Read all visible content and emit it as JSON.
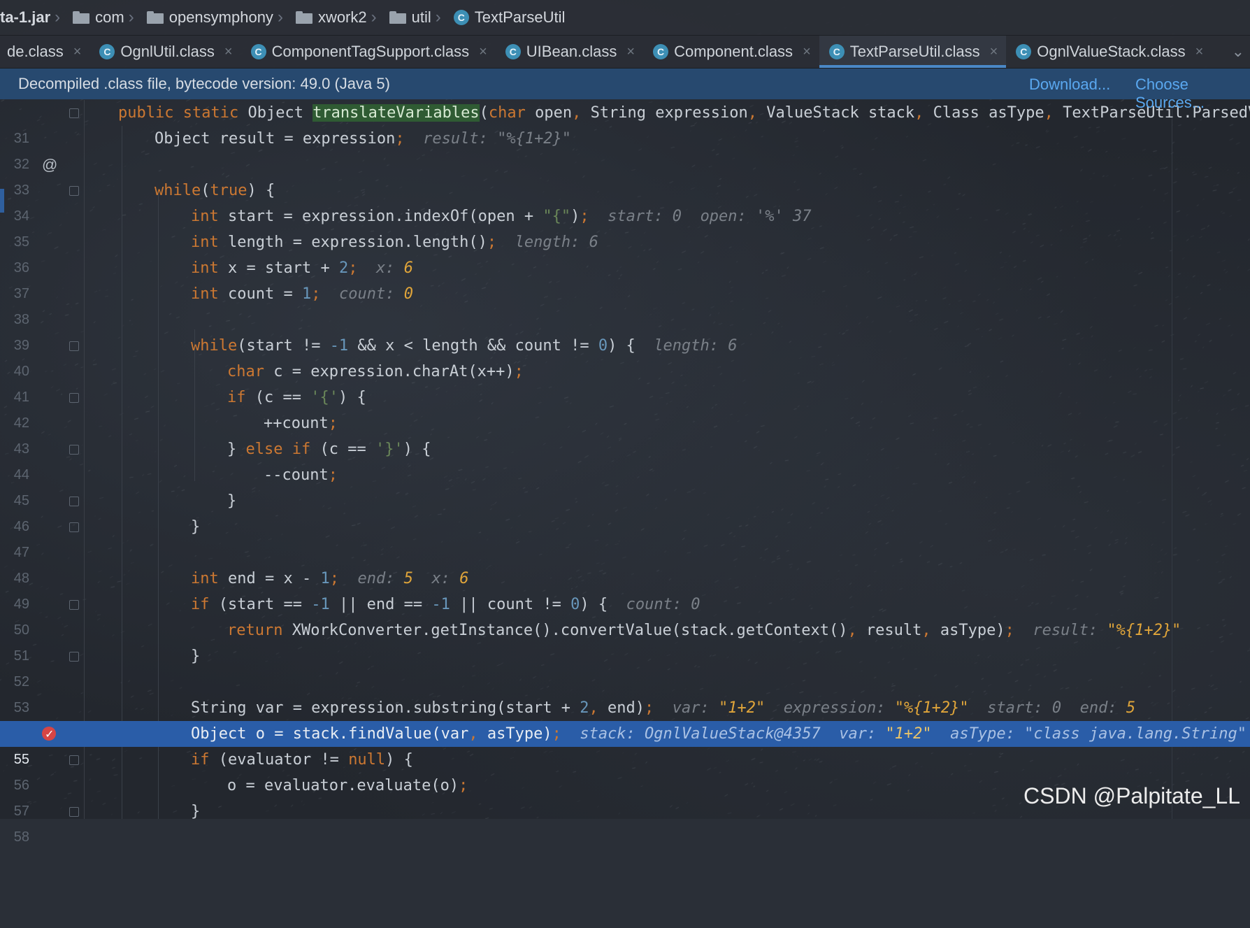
{
  "breadcrumb": [
    {
      "label": "ta-1.jar",
      "icon": "none"
    },
    {
      "label": "com",
      "icon": "folder-icon"
    },
    {
      "label": "opensymphony",
      "icon": "folder-icon"
    },
    {
      "label": "xwork2",
      "icon": "folder-icon"
    },
    {
      "label": "util",
      "icon": "folder-icon"
    },
    {
      "label": "TextParseUtil",
      "icon": "class-icon"
    }
  ],
  "tabs": [
    {
      "label": "de.class",
      "icon": "none",
      "active": false
    },
    {
      "label": "OgnlUtil.class",
      "icon": "class-icon",
      "active": false
    },
    {
      "label": "ComponentTagSupport.class",
      "icon": "class-icon",
      "active": false
    },
    {
      "label": "UIBean.class",
      "icon": "class-icon",
      "active": false
    },
    {
      "label": "Component.class",
      "icon": "class-icon",
      "active": false
    },
    {
      "label": "TextParseUtil.class",
      "icon": "class-icon",
      "active": true
    },
    {
      "label": "OgnlValueStack.class",
      "icon": "class-icon",
      "active": false
    }
  ],
  "tab_close_glyph": "×",
  "banner": {
    "message": "Decompiled .class file, bytecode version: 49.0 (Java 5)",
    "download": "Download...",
    "choose_sources": "Choose Sources..."
  },
  "annotations": {
    "override_marker": "@"
  },
  "lines": [
    {
      "n": "31",
      "fold": true
    },
    {
      "n": "32"
    },
    {
      "n": "33"
    },
    {
      "n": "34",
      "fold": true
    },
    {
      "n": "35"
    },
    {
      "n": "36"
    },
    {
      "n": "37"
    },
    {
      "n": "38"
    },
    {
      "n": "39"
    },
    {
      "n": "40",
      "fold": true
    },
    {
      "n": "41"
    },
    {
      "n": "42",
      "fold": true
    },
    {
      "n": "43"
    },
    {
      "n": "44",
      "fold": true
    },
    {
      "n": "45"
    },
    {
      "n": "46",
      "fold": true
    },
    {
      "n": "47",
      "fold": true
    },
    {
      "n": "48"
    },
    {
      "n": "49"
    },
    {
      "n": "50",
      "fold": true
    },
    {
      "n": "51"
    },
    {
      "n": "52",
      "fold": true
    },
    {
      "n": "53"
    },
    {
      "n": "54"
    },
    {
      "n": "55",
      "breakpoint": true,
      "current": true
    },
    {
      "n": "56",
      "fold": true
    },
    {
      "n": "57"
    },
    {
      "n": "58",
      "fold": true
    }
  ],
  "code": {
    "l31": {
      "pub": "public",
      "sta": "static",
      "obj": "Object ",
      "fn": "translateVariables",
      "p1": "(",
      "chr": "char",
      "p2": " open",
      "c1": ",",
      "p3": " String expression",
      "c2": ",",
      "p4": " ValueStack stack",
      "c3": ",",
      "p5": " Class asType",
      "c4": ",",
      "p6": " TextParseUtil.ParsedVal"
    },
    "l32": {
      "a": "Object result = expression",
      "semi": ";",
      "hint": "result: \"%{1+2}\""
    },
    "l34": {
      "kw": "while",
      "p": "(",
      "kw2": "true",
      "rest": ") {"
    },
    "l35": {
      "kw": "int",
      "a": " start = expression.indexOf(open + ",
      "s": "\"{\"",
      "b": ")",
      "semi": ";",
      "hint1": "start: 0",
      "hint2": "open: '%' 37"
    },
    "l36": {
      "kw": "int",
      "a": " length = expression.length()",
      "semi": ";",
      "hint": "length: 6"
    },
    "l37": {
      "kw": "int",
      "a": " x = start + ",
      "num": "2",
      "semi": ";",
      "hint": "x: ",
      "val": "6"
    },
    "l38": {
      "kw": "int",
      "a": " count = ",
      "num": "1",
      "semi": ";",
      "hint": "count: ",
      "val": "0"
    },
    "l40": {
      "kw": "while",
      "a": "(start != ",
      "n1": "-1",
      "b": " && x < length && count != ",
      "n2": "0",
      "c": ") {",
      "hint": "length: 6"
    },
    "l41": {
      "kw": "char",
      "a": " c = expression.charAt(x++)",
      "semi": ";"
    },
    "l42": {
      "kw": "if",
      "a": " (c == ",
      "s": "'{'",
      "b": ") {"
    },
    "l43": {
      "a": "++count",
      "semi": ";"
    },
    "l44": {
      "a": "} ",
      "kw": "else",
      "sp": " ",
      "kw2": "if",
      "b": " (c == ",
      "s": "'}'",
      "c": ") {"
    },
    "l45": {
      "a": "--count",
      "semi": ";"
    },
    "l46": {
      "a": "}"
    },
    "l47": {
      "a": "}"
    },
    "l49": {
      "kw": "int",
      "a": " end = x - ",
      "num": "1",
      "semi": ";",
      "hint": "end: ",
      "val": "5",
      "hint2": "x: ",
      "val2": "6"
    },
    "l50": {
      "kw": "if",
      "a": " (start == ",
      "n1": "-1",
      "b": " || end == ",
      "n2": "-1",
      "c": " || count != ",
      "n3": "0",
      "d": ") {",
      "hint": "count: 0"
    },
    "l51": {
      "kw": "return",
      "a": " XWorkConverter.getInstance().convertValue(stack.getContext()",
      "c1": ",",
      "b": " result",
      "c2": ",",
      "c": " asType)",
      "semi": ";",
      "hint": "result: ",
      "val": "\"%{1+2}\""
    },
    "l52": {
      "a": "}"
    },
    "l54": {
      "a": "String var = expression.substring(start + ",
      "num": "2",
      "c1": ",",
      "b": " end)",
      "semi": ";",
      "h1": "var: ",
      "v1": "\"1+2\"",
      "h2": "expression: ",
      "v2": "\"%{1+2}\"",
      "h3": "start: 0",
      "h4": "end: ",
      "v4": "5"
    },
    "l55": {
      "a": "Object o = stack.findValue(var",
      "c1": ",",
      "b": " asType)",
      "semi": ";",
      "h1": "stack: OgnlValueStack@4357",
      "h2": "var: ",
      "v2": "\"1+2\"",
      "h3": "asType: \"class java.lang.String\""
    },
    "l56": {
      "kw": "if",
      "a": " (evaluator != ",
      "kw2": "null",
      "b": ") {"
    },
    "l57": {
      "a": "o = evaluator.evaluate(o)",
      "semi": ";"
    },
    "l58": {
      "a": "}"
    }
  },
  "watermark": "CSDN @Palpitate_LL",
  "colors": {
    "keyword": "#cc7832",
    "string": "#6a8759",
    "number": "#6897bb",
    "hint": "#7a8088",
    "hint_value": "#e0a53a",
    "current_line": "#2a5da8",
    "banner": "#27496f",
    "link": "#5aa8f0"
  }
}
